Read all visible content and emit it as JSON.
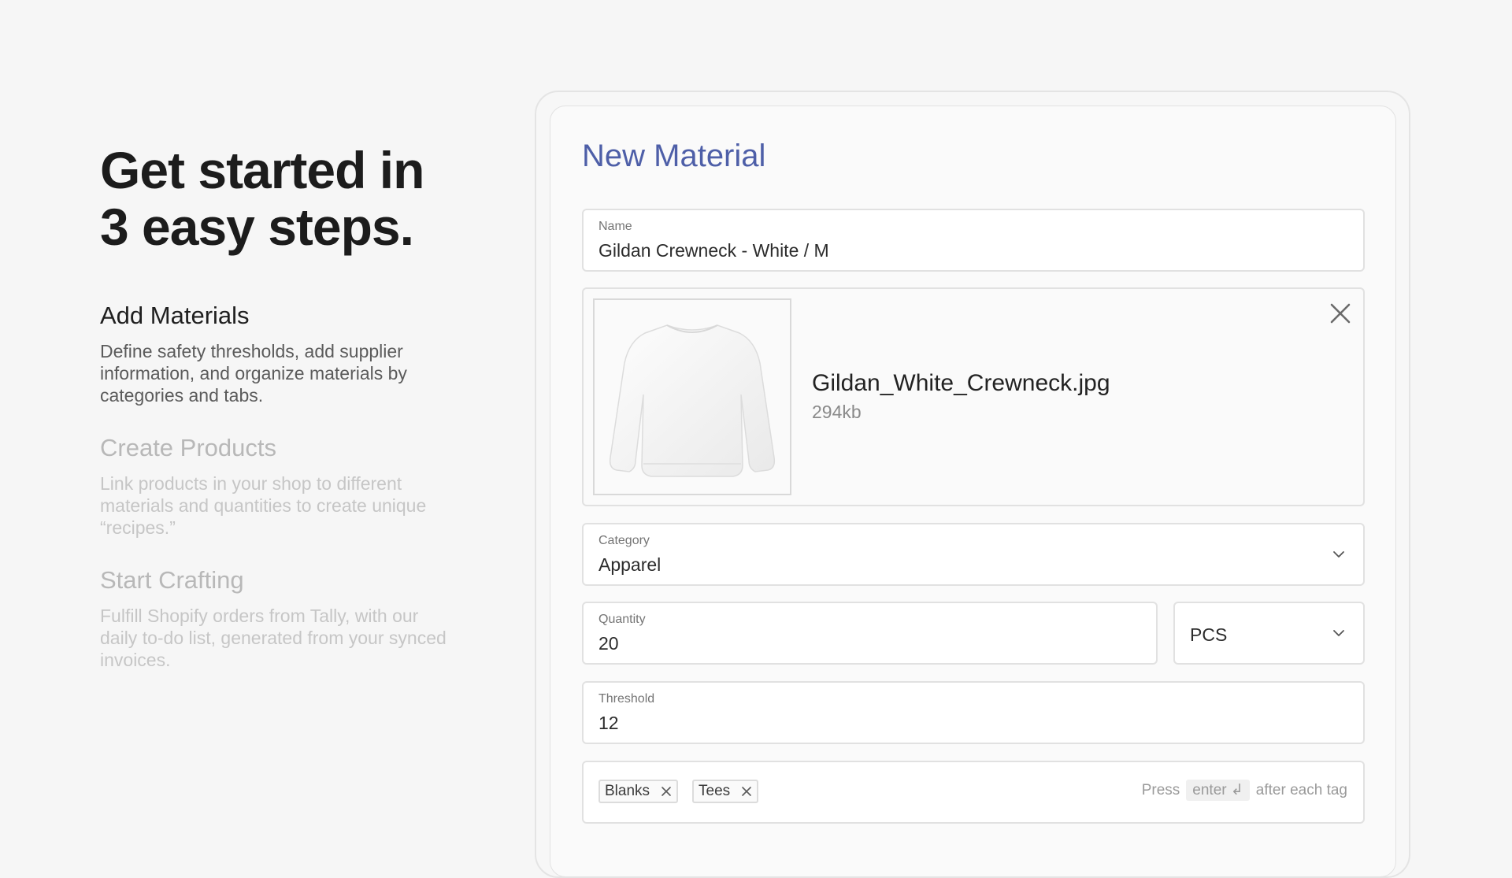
{
  "hero": {
    "line1": "Get started in",
    "line2": "3 easy steps."
  },
  "steps": [
    {
      "title": "Add Materials",
      "description": "Define safety thresholds, add supplier information, and organize materials by categories and tabs.",
      "state": "active"
    },
    {
      "title": "Create Products",
      "description": "Link products in your shop to different materials and quantities to create unique “recipes.”",
      "state": "inactive"
    },
    {
      "title": "Start Crafting",
      "description": "Fulfill Shopify orders from Tally, with our daily to-do list, generated from your synced invoices.",
      "state": "inactive"
    }
  ],
  "form": {
    "title": "New Material",
    "name": {
      "label": "Name",
      "value": "Gildan Crewneck  - White / M"
    },
    "upload": {
      "file_name": "Gildan_White_Crewneck.jpg",
      "file_size": "294kb"
    },
    "category": {
      "label": "Category",
      "value": "Apparel"
    },
    "quantity": {
      "label": "Quantity",
      "value": "20"
    },
    "unit": {
      "value": "PCS"
    },
    "threshold": {
      "label": "Threshold",
      "value": "12"
    },
    "tags": {
      "items": [
        "Blanks",
        "Tees"
      ],
      "hint_prefix": "Press",
      "hint_key": "enter ↲",
      "hint_suffix": "after each tag"
    }
  },
  "colors": {
    "accent": "#4e5fa8",
    "background": "#f6f6f6",
    "border": "#e1e1e1"
  },
  "icons": [
    "close-icon",
    "chevron-down-icon",
    "sweatshirt-image"
  ]
}
